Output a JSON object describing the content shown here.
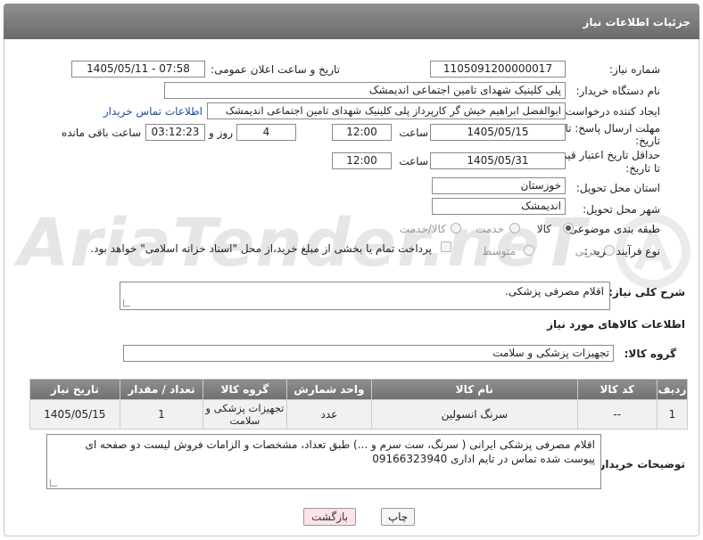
{
  "header": {
    "title": "جزئیات اطلاعات نیاز"
  },
  "watermark": {
    "text": "AriaTender.neT"
  },
  "form": {
    "need_number_label": "شماره نیاز:",
    "need_number": "1105091200000017",
    "announce_label": "تاریخ و ساعت اعلان عمومی:",
    "announce_value": "1405/05/11 - 07:58",
    "buyer_org_label": "نام دستگاه خریدار:",
    "buyer_org": "پلی کلینیک شهدای تامین اجتماعی اندیمشک",
    "creator_label": "ایجاد کننده درخواست:",
    "creator": "ابوالفضل ابراهیم خیش گر کارپرداز پلی کلینیک شهدای تامین اجتماعی اندیمشک",
    "contact_link": "اطلاعات تماس خریدار",
    "deadline_label_1": "مهلت ارسال پاسخ: تا",
    "deadline_label_2": "تاریخ:",
    "deadline_date": "1405/05/15",
    "time_label": "ساعت",
    "deadline_time": "12:00",
    "days_value": "4",
    "days_label": "روز و",
    "remaining_value": "03:12:23",
    "remaining_label": "ساعت باقی مانده",
    "validity_label_1": "حداقل تاریخ اعتبار قیمت:",
    "validity_label_2": "تا تاریخ:",
    "validity_date": "1405/05/31",
    "validity_time": "12:00",
    "province_label": "استان محل تحویل:",
    "province": "خوزستان",
    "city_label": "شهر محل تحویل:",
    "city": "اندیمشک",
    "category_label": "طبقه بندی موضوعی:",
    "category_options": [
      "کالا",
      "خدمت",
      "کالا/خدمت"
    ],
    "process_label": "نوع فرآیند خرید :",
    "process_options": [
      "جزیی",
      "متوسط"
    ],
    "payment_text": "پرداخت تمام یا بخشی از مبلغ خرید،از محل \"اسناد خزانه اسلامی\" خواهد بود."
  },
  "summary": {
    "label": "شرح کلی نیاز:",
    "value": "اقلام مصرفی پزشکی."
  },
  "goods": {
    "section_title": "اطلاعات کالاهای مورد نیاز",
    "group_label": "گروه کالا:",
    "group_value": "تجهیزات پزشکی و سلامت",
    "columns": [
      "ردیف",
      "کد کالا",
      "نام کالا",
      "واحد شمارش",
      "گروه کالا",
      "تعداد / مقدار",
      "تاریخ نیاز"
    ],
    "rows": [
      [
        "1",
        "--",
        "سرنگ انسولین",
        "عدد",
        "تجهیزات پزشکی و سلامت",
        "1",
        "1405/05/15"
      ]
    ]
  },
  "buyer_notes": {
    "label": "توضیحات خریدار:",
    "value": "اقلام مصرفی پزشکی ایرانی ( سرنگ، ست سرم و ...) طبق تعداد، مشخصات و الزامات فروش لیست دو صفحه ای پیوست شده تماس در تایم اداری 09166323940"
  },
  "buttons": {
    "print": "چاپ",
    "back": "بازگشت"
  }
}
